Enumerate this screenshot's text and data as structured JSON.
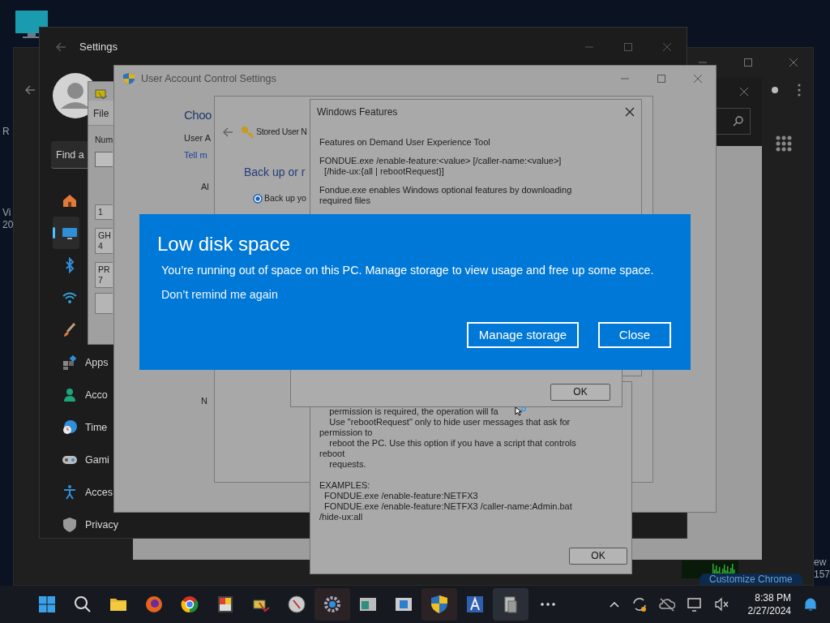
{
  "desktop": {
    "left_edge_texts": [
      "R",
      "Vi",
      "20"
    ],
    "right_edge_texts": [
      "ew",
      "157"
    ]
  },
  "browser_window": {
    "footer_button": "Customize Chrome"
  },
  "settings_window": {
    "title": "Settings",
    "search_placeholder": "Find a",
    "nav_items": [
      {
        "selected": false
      },
      {
        "selected": true
      },
      {
        "selected": false
      },
      {
        "selected": false
      },
      {
        "selected": false
      },
      {
        "label": "Apps",
        "selected": false
      },
      {
        "label": "Acco",
        "selected": false
      },
      {
        "label": "Time",
        "selected": false
      },
      {
        "label": "Gami",
        "selected": false
      },
      {
        "label": "Acces",
        "selected": false
      },
      {
        "label": "Privacy",
        "selected": false
      }
    ]
  },
  "file_window": {
    "menu": "File",
    "label": "Num",
    "cells": [
      [
        "1"
      ],
      [
        "GH",
        "4"
      ],
      [
        "PR",
        "7"
      ]
    ]
  },
  "uac_window": {
    "title": "User Account Control Settings",
    "heading": "Choo",
    "text": "User A",
    "link": "Tell m",
    "label_1": "Al",
    "label_2": "N"
  },
  "stored_user_names_window": {
    "title": "Stored User N",
    "heading": "Back up or r",
    "radio": {
      "label": "Back up yo",
      "selected": true
    }
  },
  "windows_features_dialog": {
    "title": "Windows Features",
    "paragraphs": [
      [
        "Features on Demand User Experience Tool"
      ],
      [
        "FONDUE.exe /enable-feature:<value> [/caller-name:<value>]",
        "  [/hide-ux:{all | rebootRequest}]"
      ],
      [
        "Fondue.exe enables Windows optional features by downloading",
        "required files"
      ]
    ]
  },
  "message_box": {
    "ok_button": "OK"
  },
  "windows_features_dialog_2": {
    "paragraphs": [
      [
        "    permission is required, the operation will fa",
        "    Use \"rebootRequest\" only to hide user messages that ask for",
        "permission to",
        "    reboot the PC. Use this option if you have a script that controls",
        "reboot",
        "    requests."
      ],
      [
        "EXAMPLES:",
        "  FONDUE.exe /enable-feature:NETFX3",
        "  FONDUE.exe /enable-feature:NETFX3 /caller-name:Admin.bat",
        "/hide-ux:all"
      ]
    ],
    "ok_button": "OK"
  },
  "toast": {
    "title": "Low disk space",
    "message": "You’re running out of space on this PC. Manage storage to view usage and free up some space.",
    "link": "Don’t remind me again",
    "buttons": [
      "Manage storage",
      "Close"
    ]
  },
  "taskbar": {
    "time": "8:38 PM",
    "date": "2/27/2024"
  }
}
